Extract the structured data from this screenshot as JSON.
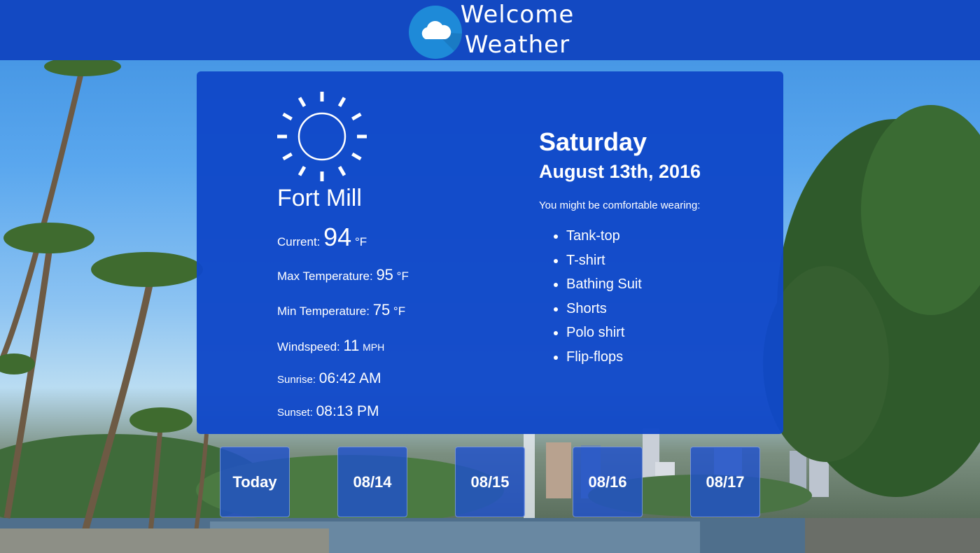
{
  "header": {
    "brand_line1": "Welcome",
    "brand_line2": "Weather",
    "logo_icon": "cloud-icon",
    "background_color": "#1349c2"
  },
  "current": {
    "weather_icon": "sun-icon",
    "city": "Fort Mill",
    "current_label": "Current:",
    "current_value": "94",
    "current_unit": "°F",
    "max_label": "Max Temperature:",
    "max_value": "95",
    "max_unit": "°F",
    "min_label": "Min Temperature:",
    "min_value": "75",
    "min_unit": "°F",
    "wind_label": "Windspeed:",
    "wind_value": "11",
    "wind_unit": "MPH",
    "sunrise_label": "Sunrise:",
    "sunrise_value": "06:42 AM",
    "sunset_label": "Sunset:",
    "sunset_value": "08:13 PM"
  },
  "details": {
    "day": "Saturday",
    "date": "August 13th, 2016",
    "suggestion_label": "You might be comfortable wearing:",
    "clothes": [
      "Tank-top",
      "T-shirt",
      "Bathing Suit",
      "Shorts",
      "Polo shirt",
      "Flip-flops"
    ]
  },
  "forecast": {
    "tabs": [
      "Today",
      "08/14",
      "08/15",
      "08/16",
      "08/17"
    ]
  },
  "colors": {
    "card": "#1048c8",
    "accent": "#1349c2",
    "logo": "#1e8ad8"
  }
}
